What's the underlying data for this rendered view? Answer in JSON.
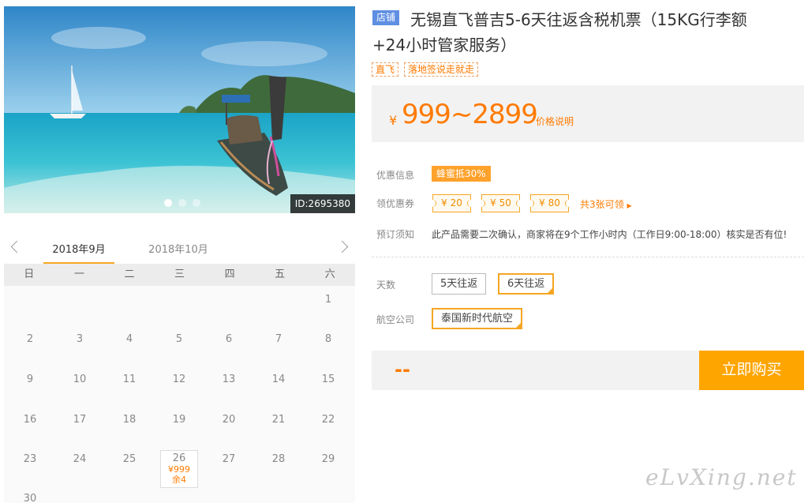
{
  "photo": {
    "id_label": "ID:2695380",
    "slides": 3,
    "active_slide": 1
  },
  "calendar": {
    "months": [
      "2018年9月",
      "2018年10月"
    ],
    "weekdays": [
      "日",
      "一",
      "二",
      "三",
      "四",
      "五",
      "六"
    ],
    "days": [
      "1",
      "2",
      "3",
      "4",
      "5",
      "6",
      "7",
      "8",
      "9",
      "10",
      "11",
      "12",
      "13",
      "14",
      "15",
      "16",
      "17",
      "18",
      "19",
      "20",
      "21",
      "22",
      "23",
      "24",
      "25",
      "26",
      "27",
      "28",
      "29",
      "30"
    ],
    "selected": {
      "day": "26",
      "price": "¥999",
      "remain": "余4"
    }
  },
  "product": {
    "shop_badge": "店铺",
    "title_line1": "无锡直飞普吉5-6天往返含税机票（15KG行李额",
    "title_line2": "+24小时管家服务）",
    "tags": [
      "直飞",
      "落地签说走就走"
    ],
    "price": {
      "currency": "¥",
      "range": "999~2899",
      "explain": "价格说明"
    }
  },
  "info": {
    "promo_label": "优惠信息",
    "promo_badge": "蜂蜜抵30%",
    "coupon_label": "领优惠券",
    "coupons": [
      "¥ 20",
      "¥ 50",
      "¥ 80"
    ],
    "coupon_count": "共3张可领",
    "notice_label": "预订须知",
    "notice_text": "此产品需要二次确认，商家将在9个工作小时内（工作日9:00-18:00）核实是否有位!"
  },
  "options": {
    "days_label": "天数",
    "days": [
      "5天往返",
      "6天往返"
    ],
    "days_selected": 1,
    "airline_label": "航空公司",
    "airlines": [
      "泰国新时代航空"
    ],
    "airline_selected": 0
  },
  "buy": {
    "total": "--",
    "button": "立即购买"
  },
  "watermark": "eLvXing.net",
  "colors": {
    "accent": "#ff7a00",
    "button": "#fea500",
    "shop_badge": "#5f8fe2"
  }
}
